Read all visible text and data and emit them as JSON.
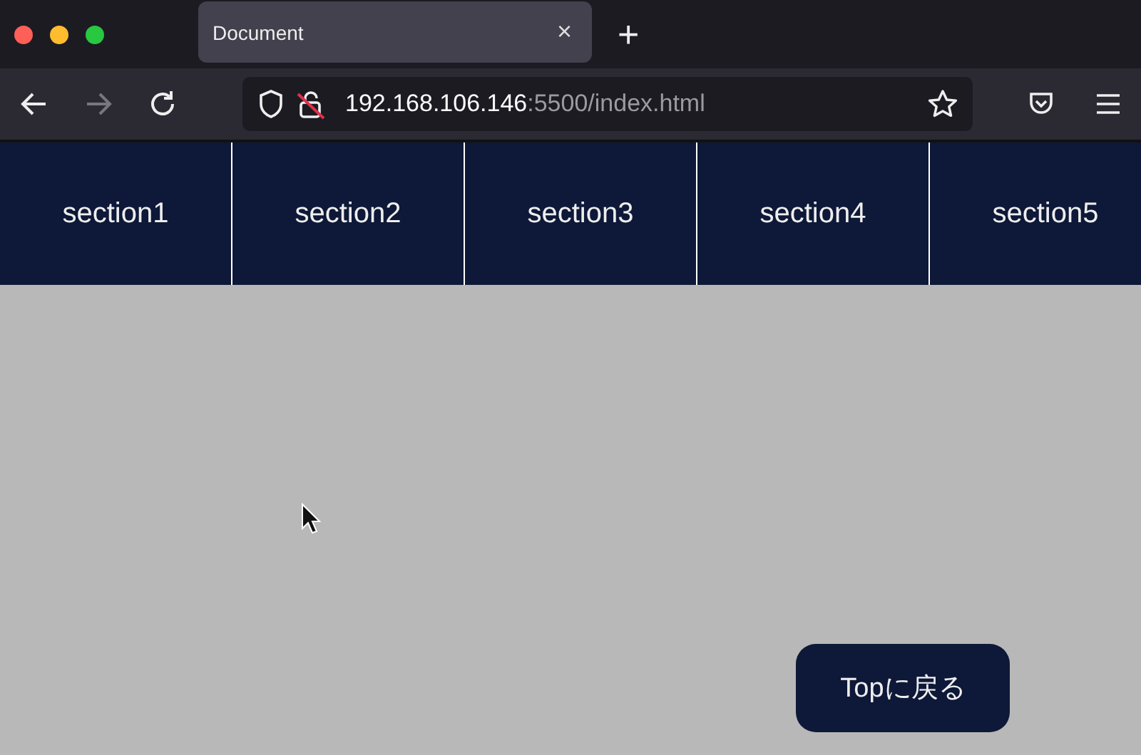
{
  "browser": {
    "tab": {
      "title": "Document",
      "close": "×",
      "selected": true
    },
    "new_tab": "+",
    "url_host": "192.168.106.146",
    "url_path": ":5500/index.html",
    "forward_disabled": true
  },
  "nav": {
    "items": [
      {
        "label": "section1"
      },
      {
        "label": "section2"
      },
      {
        "label": "section3"
      },
      {
        "label": "section4"
      },
      {
        "label": "section5"
      }
    ]
  },
  "top_button": "Topに戻る"
}
